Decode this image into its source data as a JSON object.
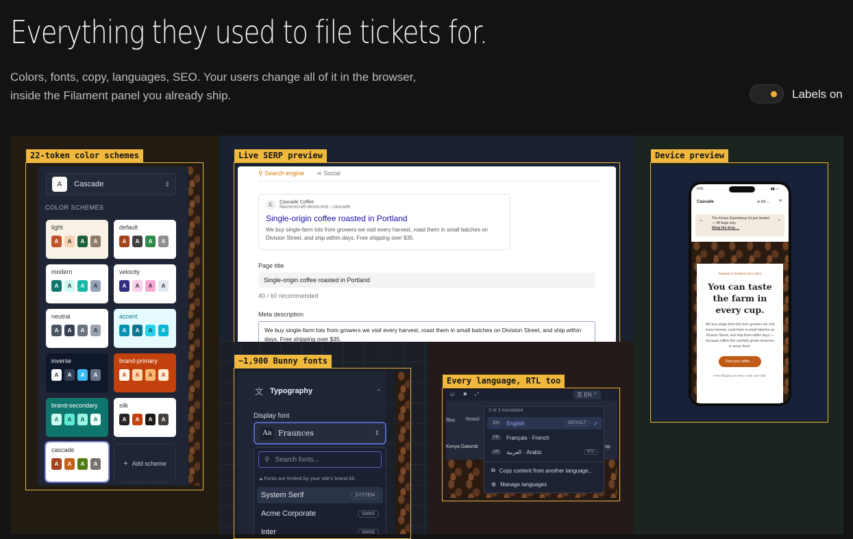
{
  "hero": {
    "title": "Everything they used to file tickets for.",
    "subtitle_line1": "Colors, fonts, copy, languages, SEO. Your users change all of it in the browser,",
    "subtitle_line2": "inside the Filament panel you already ship.",
    "toggle_label": "Labels on"
  },
  "colors": {
    "accent": "#f0b83d",
    "panel_bg": "#1f2534"
  },
  "color_schemes": {
    "tag": "22-token color schemes",
    "selected_theme": "Cascade",
    "selected_theme_letter": "A",
    "heading": "COLOR SCHEMES",
    "add_label": "Add scheme",
    "cards": [
      {
        "name": "light",
        "bg": "#f7f1e6",
        "fg": "#333",
        "chips": [
          [
            "A",
            "#c0532a",
            "#fff"
          ],
          [
            "A",
            "#f3d3b0",
            "#333"
          ],
          [
            "A",
            "#1f5e3a",
            "#fff"
          ],
          [
            "A",
            "#8c7c69",
            "#fff"
          ]
        ]
      },
      {
        "name": "default",
        "bg": "#ffffff",
        "fg": "#333",
        "chips": [
          [
            "A",
            "#a3431e",
            "#fff"
          ],
          [
            "A",
            "#3f3f3f",
            "#fff"
          ],
          [
            "A",
            "#2f8a4c",
            "#fff"
          ],
          [
            "A",
            "#8f8f8f",
            "#fff"
          ]
        ]
      },
      {
        "name": "modern",
        "bg": "#ffffff",
        "fg": "#333",
        "chips": [
          [
            "A",
            "#0f766e",
            "#fff"
          ],
          [
            "A",
            "#ccfbf1",
            "#333"
          ],
          [
            "A",
            "#14b8a6",
            "#fff"
          ],
          [
            "A",
            "#94a3b8",
            "#333"
          ]
        ]
      },
      {
        "name": "velocity",
        "bg": "#ffffff",
        "fg": "#333",
        "chips": [
          [
            "A",
            "#312e81",
            "#fff"
          ],
          [
            "A",
            "#fbcfe8",
            "#333"
          ],
          [
            "A",
            "#f9a8d4",
            "#333"
          ],
          [
            "A",
            "#e2e8f0",
            "#333"
          ]
        ]
      },
      {
        "name": "neutral",
        "bg": "#ffffff",
        "fg": "#333",
        "chips": [
          [
            "A",
            "#4b5563",
            "#fff"
          ],
          [
            "A",
            "#374151",
            "#fff"
          ],
          [
            "A",
            "#6b7280",
            "#fff"
          ],
          [
            "A",
            "#9ca3af",
            "#333"
          ]
        ]
      },
      {
        "name": "accent",
        "bg": "#e6fbff",
        "fg": "#0e7490",
        "chips": [
          [
            "A",
            "#0891b2",
            "#fff"
          ],
          [
            "A",
            "#0e7490",
            "#fff"
          ],
          [
            "A",
            "#22d3ee",
            "#333"
          ],
          [
            "A",
            "#06b6d4",
            "#fff"
          ]
        ]
      },
      {
        "name": "inverse",
        "bg": "#0f172a",
        "fg": "#f1f5f9",
        "chips": [
          [
            "A",
            "#f8fafc",
            "#333"
          ],
          [
            "A",
            "#334155",
            "#fff"
          ],
          [
            "A",
            "#38bdf8",
            "#fff"
          ],
          [
            "A",
            "#64748b",
            "#fff"
          ]
        ]
      },
      {
        "name": "brand-primary",
        "bg": "#c2410c",
        "fg": "#ffffff",
        "chips": [
          [
            "A",
            "#fff7ed",
            "#c2410c"
          ],
          [
            "A",
            "#fed7aa",
            "#c2410c"
          ],
          [
            "A",
            "#fdba74",
            "#7c2d12"
          ],
          [
            "A",
            "#ffedd5",
            "#c2410c"
          ]
        ]
      },
      {
        "name": "brand-secondary",
        "bg": "#0f766e",
        "fg": "#ffffff",
        "chips": [
          [
            "A",
            "#ccfbf1",
            "#0f766e"
          ],
          [
            "A",
            "#5eead4",
            "#134e4a"
          ],
          [
            "A",
            "#99f6e4",
            "#134e4a"
          ],
          [
            "A",
            "#f0fdfa",
            "#0f766e"
          ]
        ]
      },
      {
        "name": "silk",
        "bg": "#ffffff",
        "fg": "#333",
        "chips": [
          [
            "A",
            "#292524",
            "#fff"
          ],
          [
            "A",
            "#c2410c",
            "#fff"
          ],
          [
            "A",
            "#1c1917",
            "#fff"
          ],
          [
            "A",
            "#44403c",
            "#fff"
          ]
        ]
      },
      {
        "name": "cascade",
        "bg": "#ffffff",
        "fg": "#333",
        "chips": [
          [
            "A",
            "#a3431e",
            "#fff"
          ],
          [
            "A",
            "#c2611e",
            "#fff"
          ],
          [
            "A",
            "#4d7c0f",
            "#fff"
          ],
          [
            "A",
            "#78716c",
            "#fff"
          ]
        ]
      }
    ]
  },
  "serp": {
    "tag": "Live SERP preview",
    "tab_search": "Search engine",
    "tab_social": "Social",
    "site_letter": "C",
    "site_name": "Cascade Coffee",
    "site_url": "filamentcraft-demo.test › cascade",
    "headline": "Single-origin coffee roasted in Portland",
    "description": "We buy single-farm lots from growers we visit every harvest, roast them in small batches on Division Street, and ship within days. Free shipping over $35.",
    "page_title_label": "Page title",
    "page_title_value": "Single-origin coffee roasted in Portland",
    "page_title_count": "40 / 60 recommended",
    "meta_label": "Meta description",
    "meta_value": "We buy single-farm lots from growers we visit every harvest, roast them in small batches on Division Street, and ship within days. Free shipping over $35."
  },
  "fonts": {
    "tag": "~1,900 Bunny fonts",
    "section_title": "Typography",
    "field_label": "Display font",
    "selected_preview": "Aa",
    "selected_font": "Fraunces",
    "search_placeholder": "Search fonts...",
    "note": "Fonts are limited by your site's brand kit.",
    "options": [
      {
        "name": "System Serif",
        "badge": "SYSTEM"
      },
      {
        "name": "Acme Corporate",
        "badge": "SANS"
      },
      {
        "name": "Inter",
        "badge": "SANS"
      }
    ]
  },
  "language": {
    "tag": "Every language, RTL too",
    "current": "EN",
    "count_text": "3 of 3 translated",
    "bg_text_1": "ffee",
    "bg_text_2": "Roasti",
    "bg_text_3": "Kenya Gatomb",
    "bg_text_4": "op",
    "rows": [
      {
        "code": "EN",
        "label": "English",
        "badge": "DEFAULT"
      },
      {
        "code": "FR",
        "label": "Français · French",
        "badge": ""
      },
      {
        "code": "AR",
        "label": "العربية · Arabic",
        "badge": "RTL"
      }
    ],
    "copy_action": "Copy content from another language...",
    "manage_action": "Manage languages"
  },
  "device": {
    "tag": "Device preview",
    "time": "9:41",
    "brand": "Cascade",
    "lang": "EN",
    "banner": "The Kenya Gatomboya lot just landed — 48 bags only.",
    "banner_link": "Shop the drop →",
    "eyebrow": "Roasted in Portland since 2014",
    "headline": "You can taste the farm in every cup.",
    "body": "We buy single-farm lots from growers we visit every harvest, roast them in small batches on Division Street, and ship them within days — because coffee this carefully grown deserves to arrive fresh.",
    "cta": "Find your coffee →",
    "footnote": "Free shipping on every order over $35."
  }
}
